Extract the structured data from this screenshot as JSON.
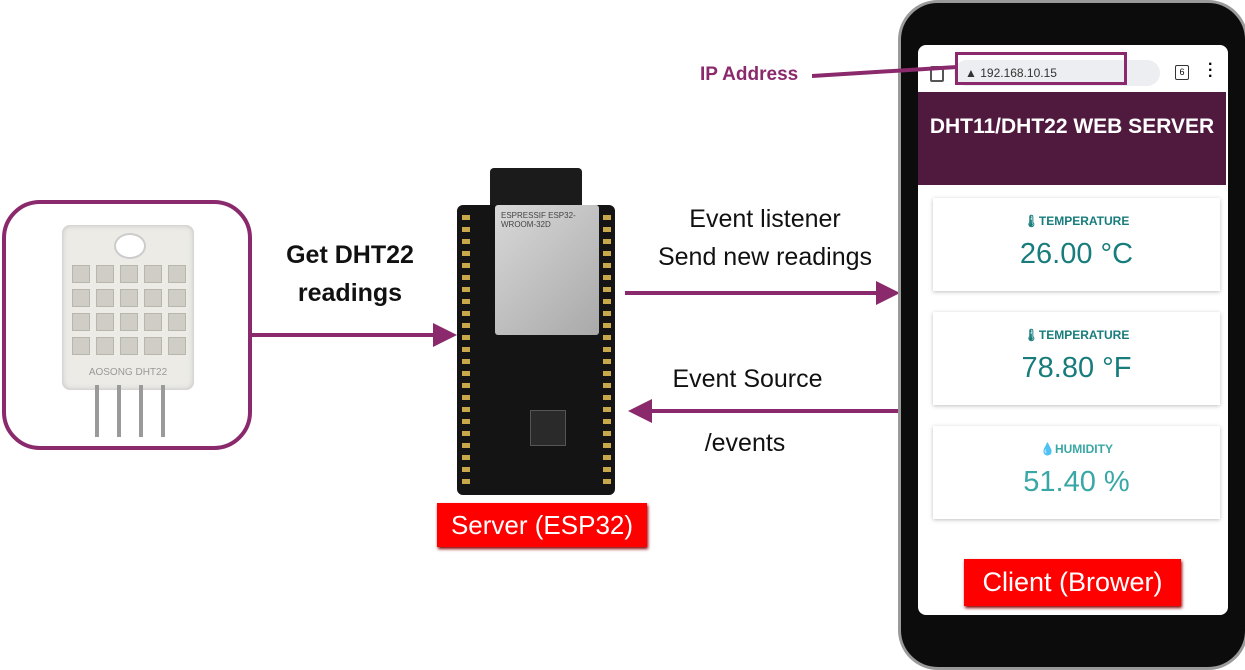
{
  "sensor": {
    "model_marking": "AOSONG DHT22"
  },
  "left_arrow_label": {
    "line1": "Get DHT22",
    "line2": "readings"
  },
  "server_label": "Server (ESP32)",
  "module_marking": "ESPRESSIF ESP32-WROOM-32D",
  "top_arrow_label": {
    "line1": "Event listener",
    "line2": "Send new readings"
  },
  "bottom_arrow_label": {
    "line1": "Event Source",
    "line2": "/events"
  },
  "ip_label": "IP Address",
  "colors": {
    "accent": "#8a2a6c",
    "header": "#4f1a3e",
    "value": "#187c7c",
    "label_bg": "#ff0000"
  },
  "phone": {
    "url": "192.168.10.15",
    "tab_count": "6",
    "title": "DHT11/DHT22 WEB SERVER",
    "cards": [
      {
        "icon": "thermometer-icon",
        "label": "TEMPERATURE",
        "value": "26.00 °C"
      },
      {
        "icon": "thermometer-icon",
        "label": "TEMPERATURE",
        "value": "78.80 °F"
      },
      {
        "icon": "water-drop-icon",
        "label": "HUMIDITY",
        "value": "51.40 %"
      }
    ]
  },
  "client_label": "Client (Brower)"
}
